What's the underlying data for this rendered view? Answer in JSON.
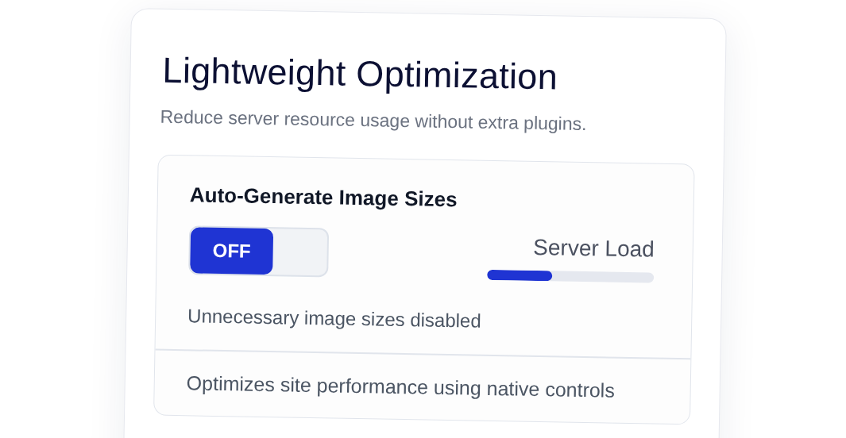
{
  "panel": {
    "title": "Lightweight Optimization",
    "subtitle": "Reduce server resource usage without extra plugins."
  },
  "setting": {
    "title": "Auto-Generate Image Sizes",
    "toggle": {
      "label": "OFF",
      "on": false
    },
    "meter": {
      "label": "Server Load",
      "level": 0.39
    },
    "note": "Unnecessary image sizes disabled"
  },
  "footer_note": "Optimizes site performance using native controls"
}
